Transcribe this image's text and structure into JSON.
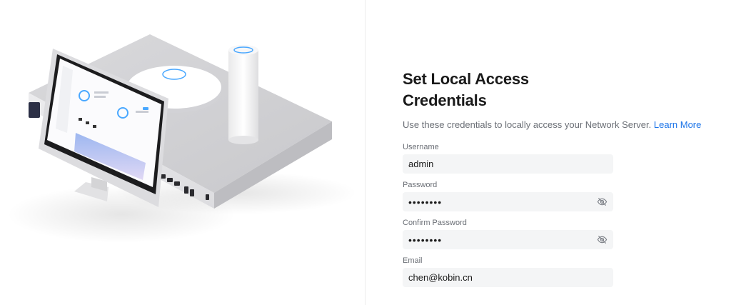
{
  "form": {
    "title": "Set Local Access Credentials",
    "subtitle": "Use these credentials to locally access your Network Server.",
    "learn_more": "Learn More",
    "fields": {
      "username": {
        "label": "Username",
        "value": "admin"
      },
      "password": {
        "label": "Password",
        "value": "PASSWORD",
        "icon": "eye-hidden-icon"
      },
      "confirm_password": {
        "label": "Confirm Password",
        "value": "PASSWORD",
        "icon": "eye-hidden-icon"
      },
      "email": {
        "label": "Email",
        "value": "chen@kobin.cn"
      }
    }
  },
  "colors": {
    "accent": "#1a73e8",
    "input_bg": "#f4f5f6",
    "label": "#6b6f76",
    "title": "#1a1a1a",
    "led_blue": "#4aa8ff"
  }
}
